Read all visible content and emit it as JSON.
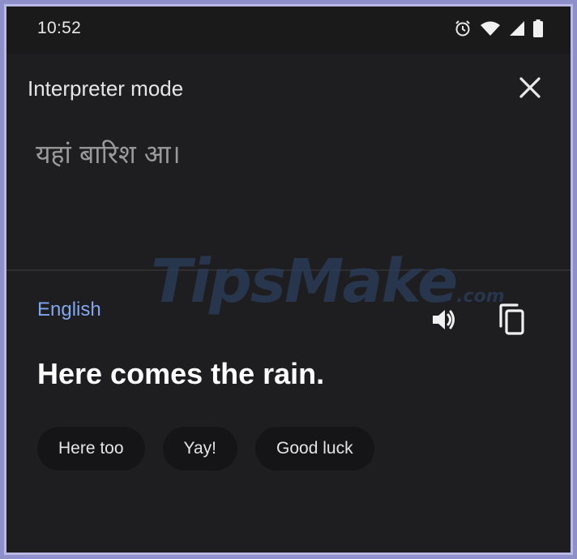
{
  "status_bar": {
    "time": "10:52",
    "icons": [
      "alarm-icon",
      "wifi-icon",
      "cell-signal-icon",
      "battery-icon"
    ]
  },
  "header": {
    "title": "Interpreter mode",
    "close_icon": "close-icon"
  },
  "source": {
    "text": "यहां बारिश आ।"
  },
  "target": {
    "language": "English",
    "translation": "Here comes the rain.",
    "speaker_icon": "speaker-icon",
    "copy_icon": "copy-icon"
  },
  "suggestions": [
    {
      "label": "Here too"
    },
    {
      "label": "Yay!"
    },
    {
      "label": "Good luck"
    }
  ],
  "watermark": {
    "main": "TipsMake",
    "suffix": ".com"
  },
  "colors": {
    "background": "#1e1e20",
    "language_accent": "#7fa6ee",
    "chip_background": "#151517",
    "frame_border": "#8f8fcc"
  }
}
